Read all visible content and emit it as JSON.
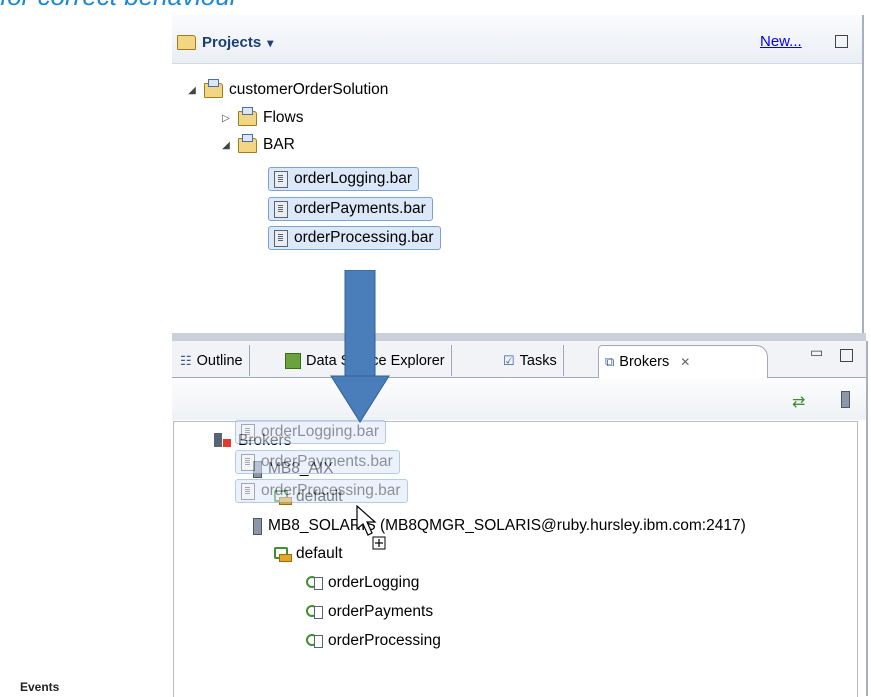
{
  "heading": "for correct behaviour",
  "projects": {
    "title": "Projects",
    "dropdown_glyph": "▾",
    "new_link": "New...",
    "tree": {
      "root": "customerOrderSolution",
      "flows": "Flows",
      "bar_folder": "BAR",
      "bar_files": [
        "orderLogging.bar",
        "orderPayments.bar",
        "orderProcessing.bar"
      ]
    }
  },
  "tabs": [
    {
      "label": "Outline",
      "icon": "outline-icon"
    },
    {
      "label": "Data Source Explorer",
      "icon": "database-icon"
    },
    {
      "label": "Tasks",
      "icon": "tasks-icon"
    },
    {
      "label": "Brokers",
      "icon": "brokers-icon",
      "active": true
    }
  ],
  "brokers": {
    "root": "Brokers",
    "items": [
      {
        "label": "MB8_AIX",
        "children": [
          {
            "label": "default",
            "flows": []
          }
        ]
      },
      {
        "label": "MB8_SOLARIS (MB8QMGR_SOLARIS@ruby.hursley.ibm.com:2417)",
        "children": [
          {
            "label": "default",
            "flows": [
              "orderLogging",
              "orderPayments",
              "orderProcessing"
            ]
          }
        ]
      }
    ]
  },
  "drag_ghost": [
    "orderLogging.bar",
    "orderPayments.bar",
    "orderProcessing.bar"
  ],
  "footer": "Events",
  "colors": {
    "arrow": "#4a7ebb",
    "heading": "#1c88d4",
    "selection": "#dbe8f8"
  }
}
